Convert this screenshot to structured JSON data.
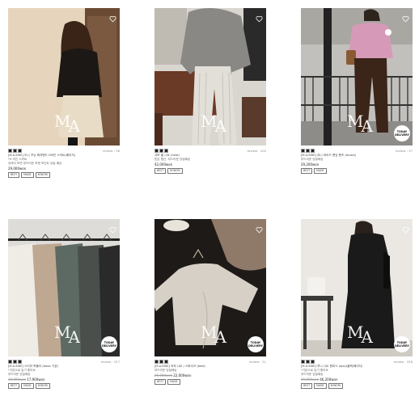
{
  "products": [
    {
      "review": "review : 36",
      "name": "[M.A.SIDE] 도니 꾸닝 배색밴드 H라인 스커트(베이지)",
      "subtitle": "*H 라인 스커트",
      "desc": "뒤에서 보면 부드러운 포켓 포인트 당일 배송",
      "old_price": "",
      "price": "29,000won",
      "tags": [
        "BEST",
        "MADE",
        "KONORI"
      ],
      "badge": false
    },
    {
      "review": "review : 100",
      "name": "샤보 울 니트 (heat)",
      "subtitle": "",
      "desc": "톤온 원단, 부드러운 당일배송",
      "old_price": "",
      "price": "42,000won",
      "tags": [
        "BEST",
        "KONORI"
      ],
      "badge": false
    },
    {
      "review": "review : 37",
      "name": "[M.A.SIDE] 르니 와이드 밴딩 팬츠 (brown)",
      "subtitle": "",
      "desc": "부드러운 당일배송",
      "old_price": "",
      "price": "29,200won",
      "tags": [
        "BEST",
        "MADE"
      ],
      "badge": true
    },
    {
      "review": "review : 157",
      "name": "[M.A.SIDE] 스티치 목폴라 (basic 기본)",
      "subtitle": "*기본으로 입기 좋아요",
      "desc": "부드러운 당일배송",
      "old_price": "19,000won",
      "price": "17,900won",
      "tags": [
        "BEST",
        "MADE",
        "KONORI"
      ],
      "badge": true
    },
    {
      "review": "review : 31",
      "name": "[M.A.SIDE] 커피 니트 / 스파이크 (best)",
      "subtitle": "부드러운 당일배송",
      "desc": "",
      "old_price": "25,000won",
      "price": "22,000won",
      "tags": [
        "BEST",
        "MADE"
      ],
      "badge": true
    },
    {
      "review": "review : 328",
      "name": "[M.A.SIDE] 루니 니트 원피스 (ops)(블랙/베이지)",
      "subtitle": "*기본으로 입기 좋아요",
      "desc": "부드러운 당일배송",
      "old_price": "49,000won",
      "price": "46,200won",
      "tags": [
        "BEST",
        "MADE",
        "KONORI"
      ],
      "badge": true
    }
  ],
  "logo_text": [
    "M",
    "A"
  ],
  "badge_text": [
    "TODAY",
    "DELIVERY"
  ],
  "icon_names": {
    "wishlist": "heart-icon"
  }
}
